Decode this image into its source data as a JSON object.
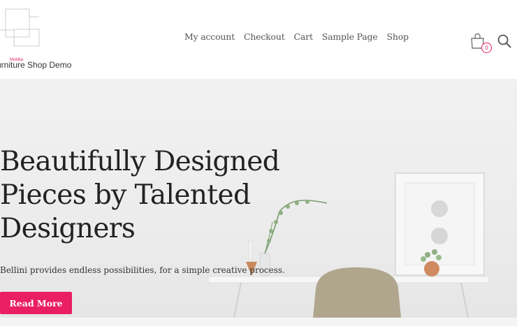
{
  "site": {
    "logo_text": "Mobilia",
    "tagline": "urniture Shop Demo"
  },
  "nav": {
    "items": [
      {
        "label": "My account"
      },
      {
        "label": "Checkout"
      },
      {
        "label": "Cart"
      },
      {
        "label": "Sample Page"
      },
      {
        "label": "Shop"
      }
    ]
  },
  "cart": {
    "icon": "shopping-bag-icon",
    "count": "0"
  },
  "search": {
    "icon": "search-icon"
  },
  "hero": {
    "title": "Beautifully Designed Pieces by Talented Designers",
    "subtitle": "Bellini provides endless possibilities, for a simple creative process.",
    "button_label": "Read More"
  },
  "colors": {
    "accent": "#e91e63",
    "text": "#222222",
    "nav_text": "#555555",
    "hero_bg": "#eeeeee"
  }
}
